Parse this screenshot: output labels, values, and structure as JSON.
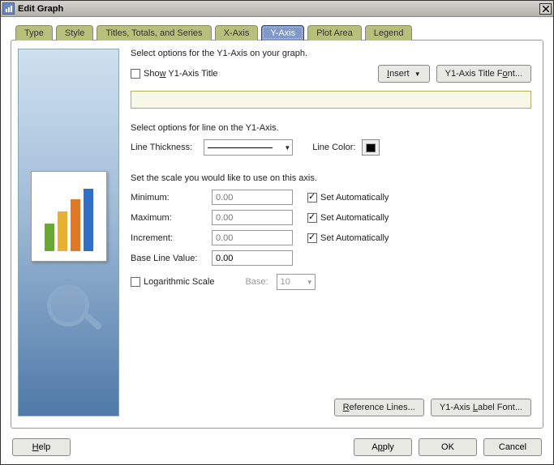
{
  "window": {
    "title": "Edit Graph"
  },
  "tabs": {
    "type": "Type",
    "style": "Style",
    "titles": "Titles, Totals, and Series",
    "xaxis": "X-Axis",
    "yaxis": "Y-Axis",
    "plot": "Plot Area",
    "legend": "Legend"
  },
  "yaxis": {
    "intro": "Select options for the Y1-Axis on your graph.",
    "show_title_label": "Show Y1-Axis Title",
    "insert_label": "Insert",
    "title_font_label": "Y1-Axis Title Font...",
    "title_value": "",
    "line_intro": "Select options for line on the Y1-Axis.",
    "line_thickness_label": "Line Thickness:",
    "line_color_label": "Line Color:",
    "scale_intro": "Set the scale you would like to use on this axis.",
    "minimum_label": "Minimum:",
    "minimum_value": "0.00",
    "maximum_label": "Maximum:",
    "maximum_value": "0.00",
    "increment_label": "Increment:",
    "increment_value": "0.00",
    "baseline_label": "Base Line Value:",
    "baseline_value": "0.00",
    "set_auto_label": "Set Automatically",
    "log_scale_label": "Logarithmic Scale",
    "base_label": "Base:",
    "base_value": "10",
    "reference_lines_label": "Reference Lines...",
    "label_font_label": "Y1-Axis Label Font..."
  },
  "footer": {
    "help": "Help",
    "apply": "Apply",
    "ok": "OK",
    "cancel": "Cancel"
  }
}
